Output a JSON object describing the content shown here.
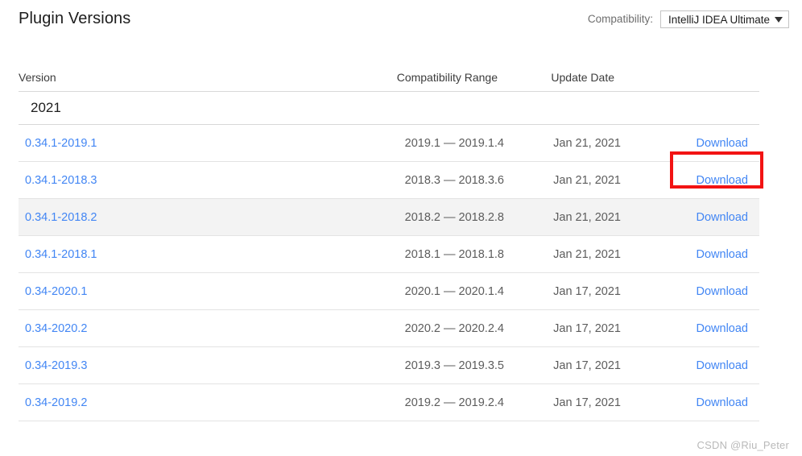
{
  "header": {
    "title": "Plugin Versions",
    "compatibility_label": "Compatibility:",
    "compatibility_value": "IntelliJ IDEA Ultimate",
    "caret_icon": "chevron-down-icon"
  },
  "table": {
    "columns": {
      "version": "Version",
      "range": "Compatibility Range",
      "date": "Update Date",
      "action": ""
    },
    "groups": [
      {
        "label": "2021",
        "rows": [
          {
            "version": "0.34.1-2019.1",
            "range": "2019.1 — 2019.1.4",
            "date": "Jan 21, 2021",
            "action": "Download",
            "hovered": false,
            "highlighted": true
          },
          {
            "version": "0.34.1-2018.3",
            "range": "2018.3 — 2018.3.6",
            "date": "Jan 21, 2021",
            "action": "Download",
            "hovered": false,
            "highlighted": false
          },
          {
            "version": "0.34.1-2018.2",
            "range": "2018.2 — 2018.2.8",
            "date": "Jan 21, 2021",
            "action": "Download",
            "hovered": true,
            "highlighted": false
          },
          {
            "version": "0.34.1-2018.1",
            "range": "2018.1 — 2018.1.8",
            "date": "Jan 21, 2021",
            "action": "Download",
            "hovered": false,
            "highlighted": false
          },
          {
            "version": "0.34-2020.1",
            "range": "2020.1 — 2020.1.4",
            "date": "Jan 17, 2021",
            "action": "Download",
            "hovered": false,
            "highlighted": false
          },
          {
            "version": "0.34-2020.2",
            "range": "2020.2 — 2020.2.4",
            "date": "Jan 17, 2021",
            "action": "Download",
            "hovered": false,
            "highlighted": false
          },
          {
            "version": "0.34-2019.3",
            "range": "2019.3 — 2019.3.5",
            "date": "Jan 17, 2021",
            "action": "Download",
            "hovered": false,
            "highlighted": false
          },
          {
            "version": "0.34-2019.2",
            "range": "2019.2 — 2019.2.4",
            "date": "Jan 17, 2021",
            "action": "Download",
            "hovered": false,
            "highlighted": false
          }
        ]
      }
    ]
  },
  "annotation": {
    "color": "#f21313",
    "target": "Download"
  },
  "watermark": {
    "text": "CSDN @Riu_Peter"
  },
  "colors": {
    "link": "#4286f4",
    "hover_row": "#f3f3f3",
    "rule": "#e3e3e3",
    "annotation": "#f21313"
  }
}
